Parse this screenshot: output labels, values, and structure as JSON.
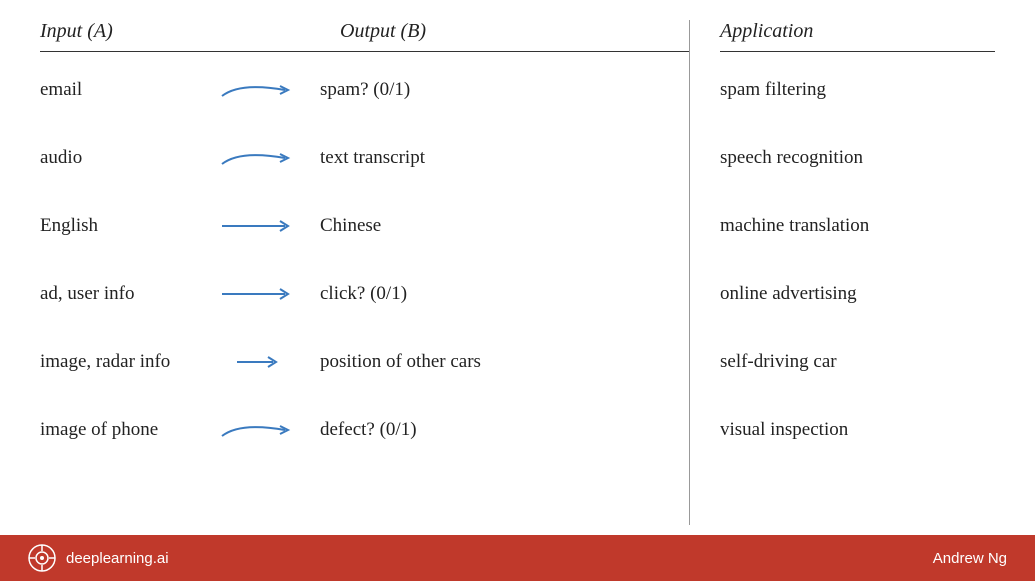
{
  "header": {
    "input_label": "Input (A)",
    "output_label": "Output (B)",
    "application_label": "Application"
  },
  "rows": [
    {
      "input": "email",
      "output": "spam? (0/1)",
      "application": "spam filtering",
      "arrow_type": "curved"
    },
    {
      "input": "audio",
      "output": "text transcript",
      "application": "speech recognition",
      "arrow_type": "curved"
    },
    {
      "input": "English",
      "output": "Chinese",
      "application": "machine translation",
      "arrow_type": "curved"
    },
    {
      "input": "ad, user info",
      "output": "click? (0/1)",
      "application": "online advertising",
      "arrow_type": "straight_long"
    },
    {
      "input": "image, radar info",
      "output": "position of other cars",
      "application": "self-driving car",
      "arrow_type": "straight_short"
    },
    {
      "input": "image of phone",
      "output": "defect? (0/1)",
      "application": "visual inspection",
      "arrow_type": "curved_medium"
    }
  ],
  "footer": {
    "brand": "deeplearning.ai",
    "author": "Andrew Ng"
  }
}
